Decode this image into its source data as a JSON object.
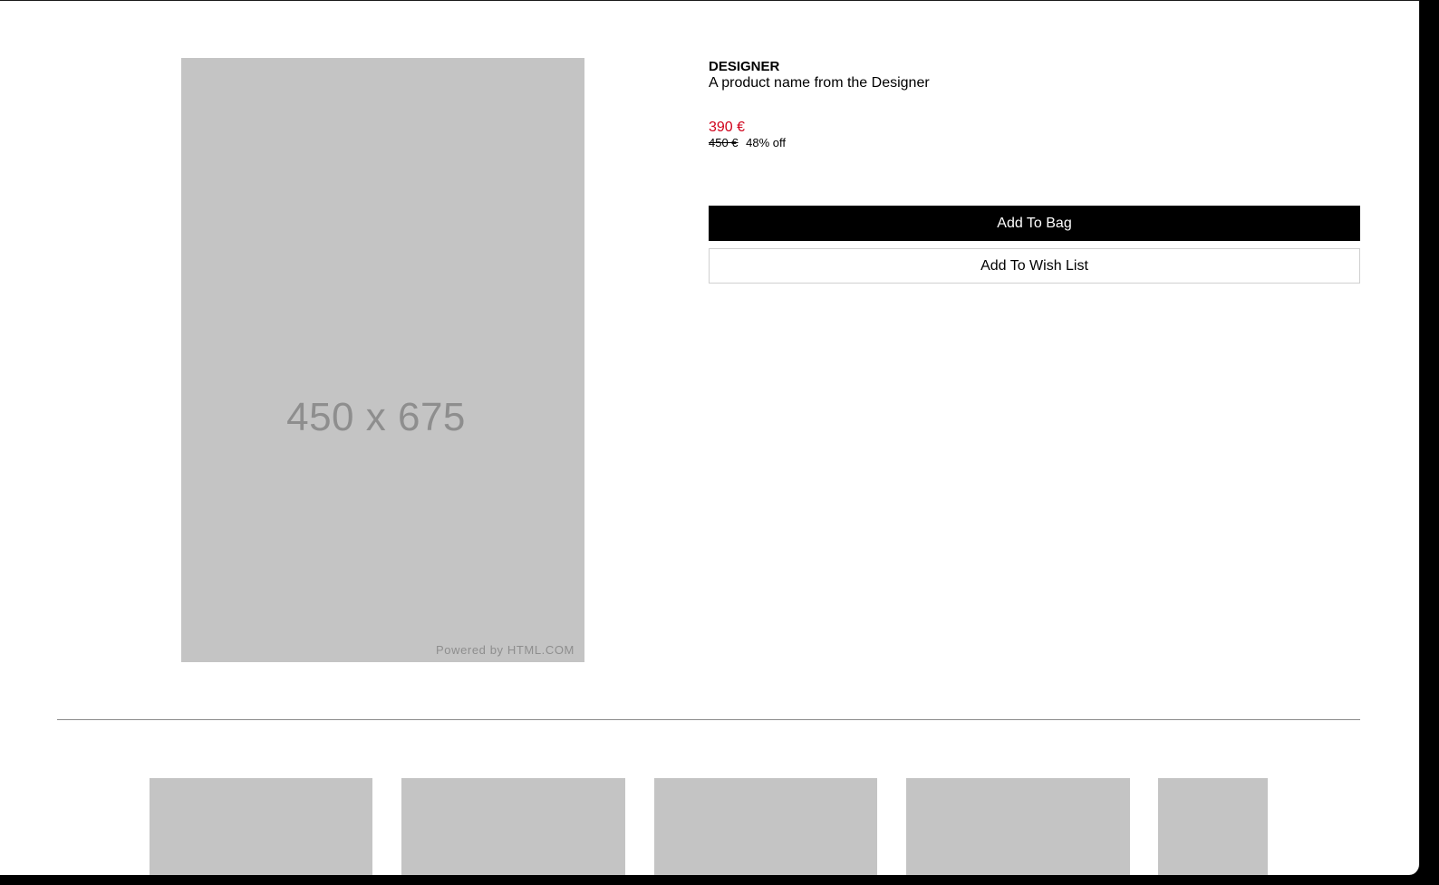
{
  "product": {
    "image_placeholder": "450 x 675",
    "image_credit": "Powered by HTML.COM",
    "designer": "DESIGNER",
    "name": "A product name from the Designer",
    "price": "390 €",
    "original_price": "450 €",
    "discount": "48% off",
    "price_color": "#d0021b"
  },
  "actions": {
    "add_to_bag": "Add To Bag",
    "add_to_wish_list": "Add To Wish List"
  },
  "related": {
    "thumbnail_count": 5
  }
}
